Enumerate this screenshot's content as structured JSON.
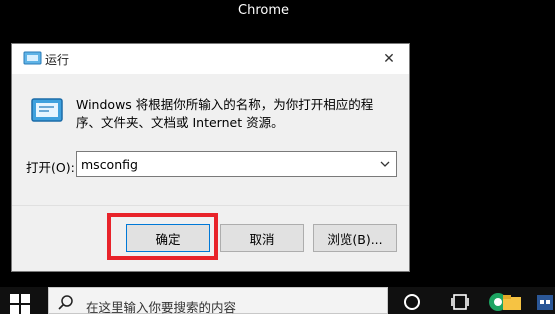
{
  "desktop": {
    "chrome_label": "Chrome"
  },
  "dialog": {
    "title": "运行",
    "description": "Windows 将根据你所输入的名称，为你打开相应的程序、文件夹、文档或 Internet 资源。",
    "open_label": "打开(O):",
    "open_value": "msconfig",
    "buttons": {
      "ok": "确定",
      "cancel": "取消",
      "browse": "浏览(B)..."
    },
    "close_symbol": "✕"
  },
  "taskbar": {
    "search_placeholder": "在这里输入你要搜索的内容"
  },
  "colors": {
    "highlight": "#e8232a",
    "ok_border": "#0078d7",
    "desktop_bg": "#000000",
    "dialog_bg": "#f0f0f0"
  }
}
